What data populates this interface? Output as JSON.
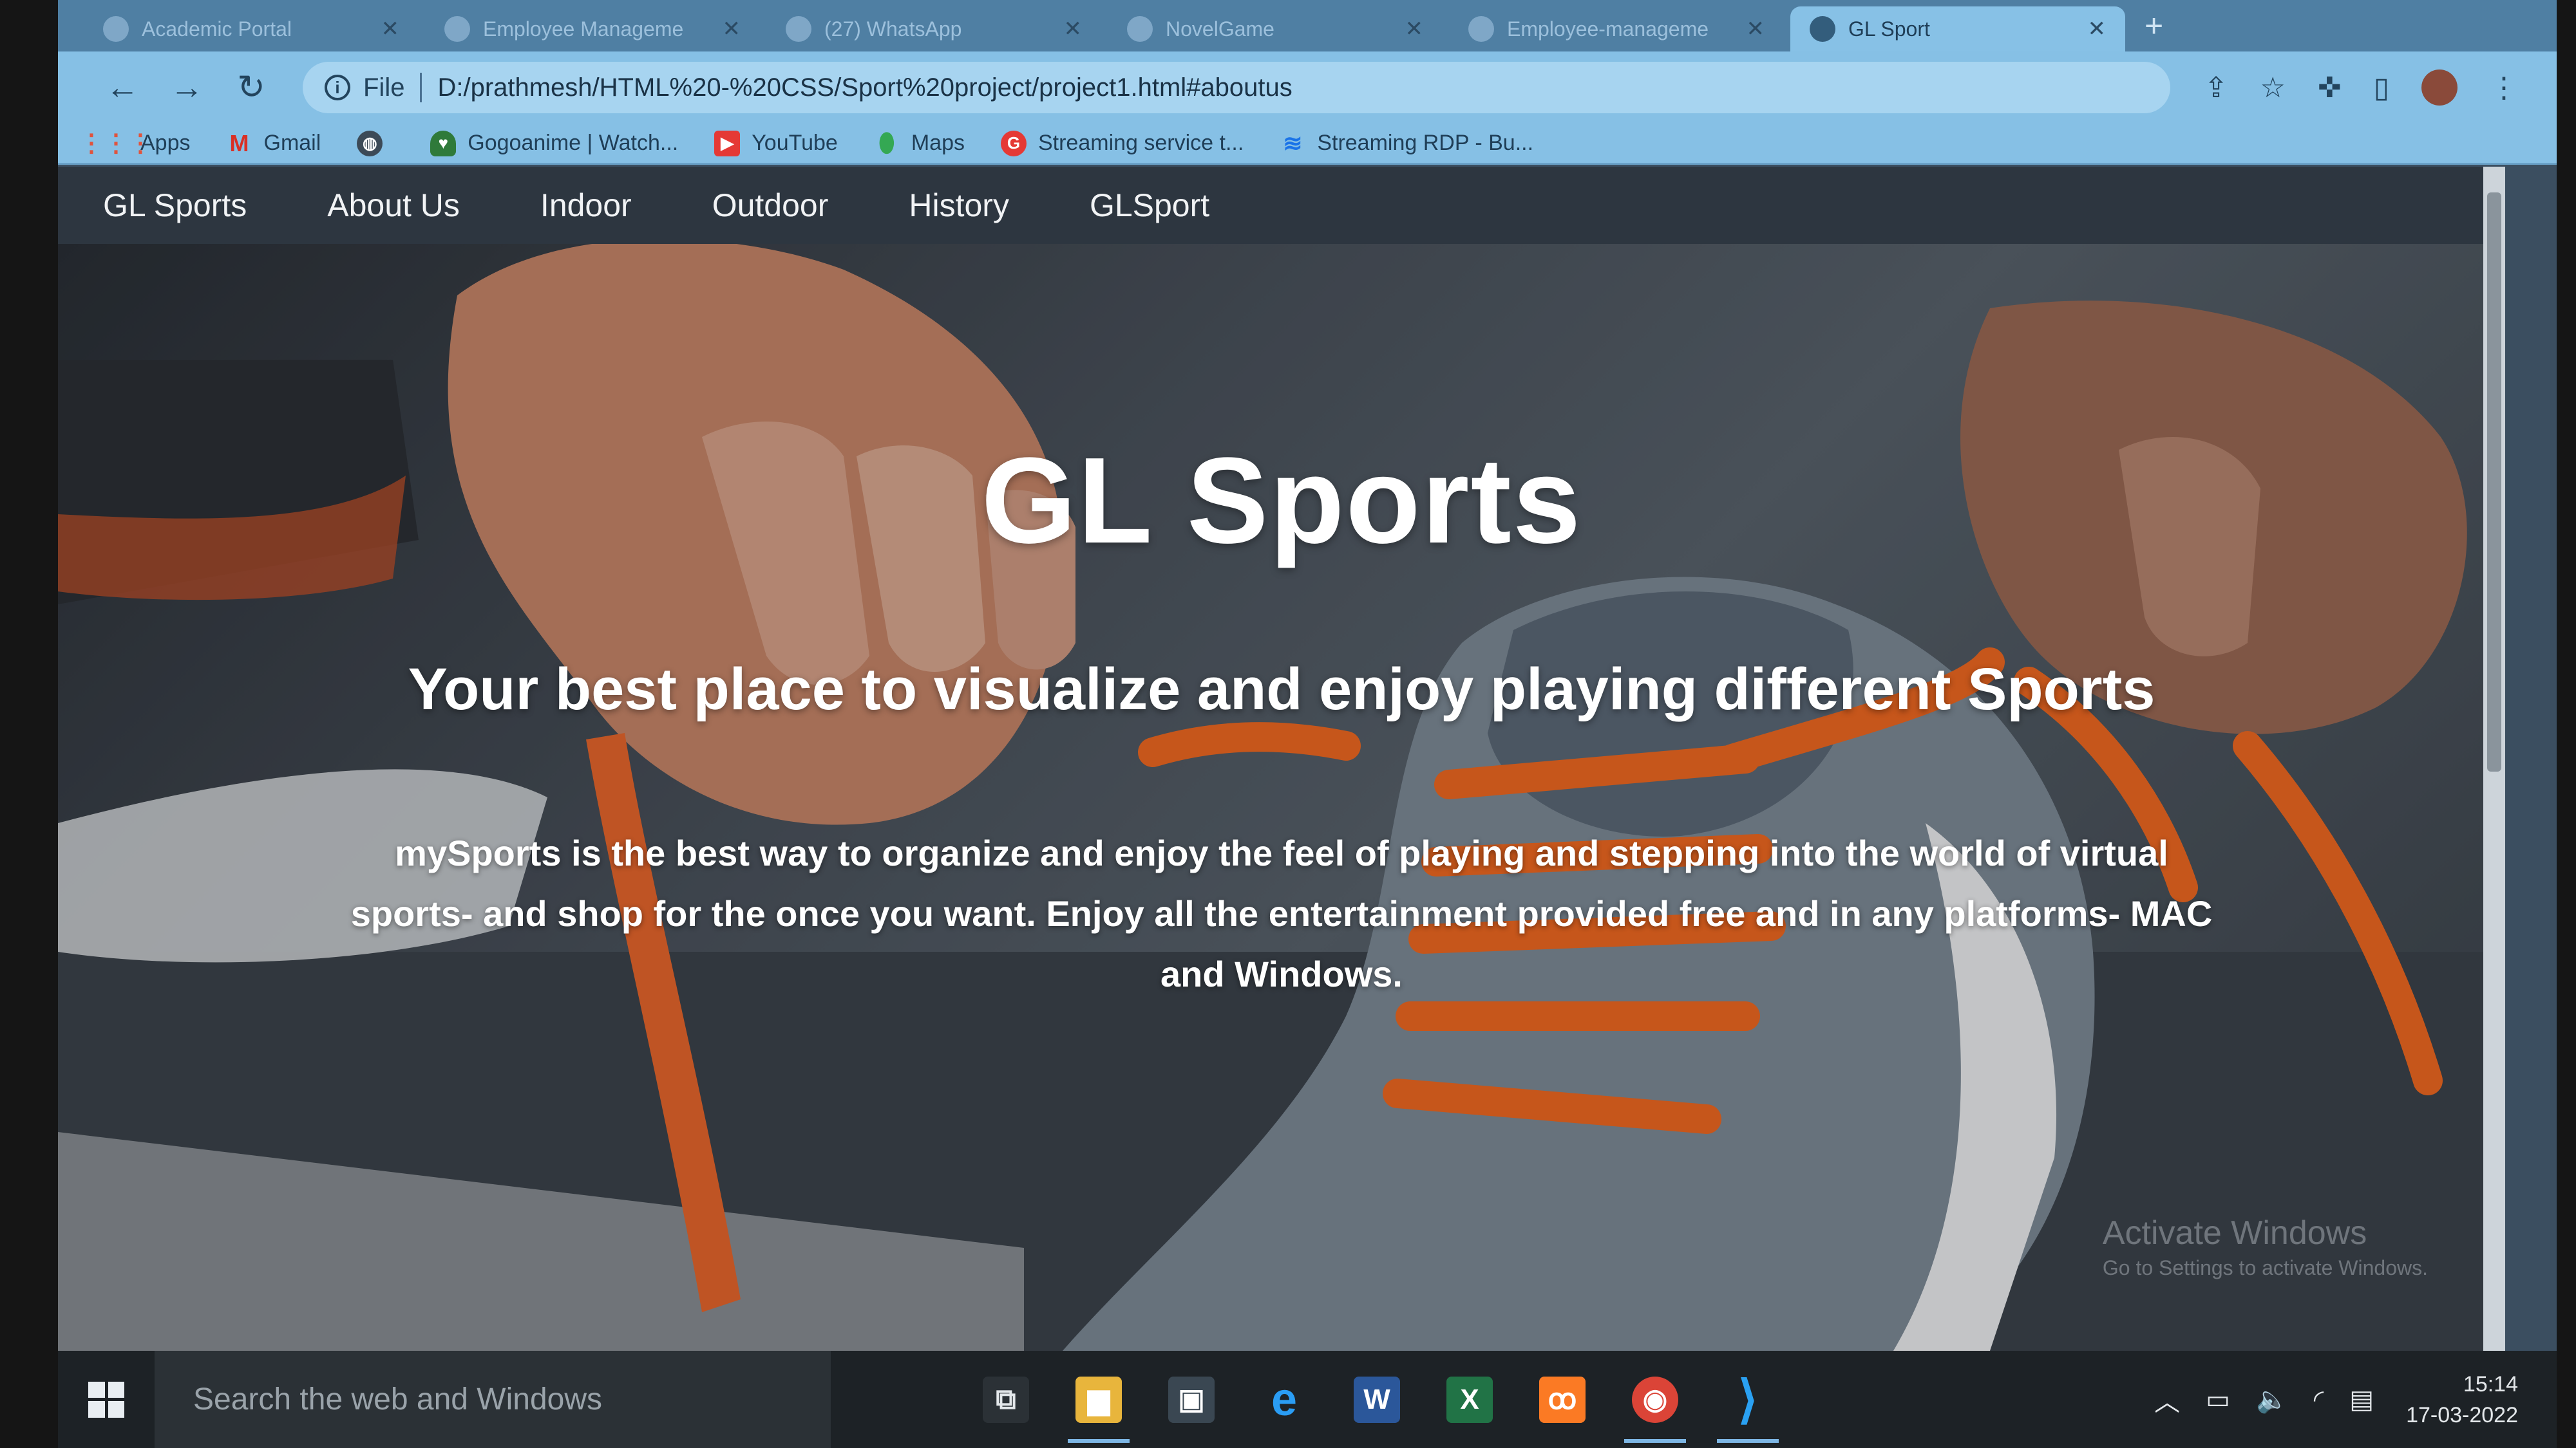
{
  "browser": {
    "tabs": [
      {
        "label": "Academic Portal",
        "active": false
      },
      {
        "label": "Employee Manageme",
        "active": false
      },
      {
        "label": "(27) WhatsApp",
        "active": false
      },
      {
        "label": "NovelGame",
        "active": false
      },
      {
        "label": "Employee-manageme",
        "active": false
      },
      {
        "label": "GL Sport",
        "active": true
      }
    ],
    "new_tab": "+",
    "url_scheme": "File",
    "url": "D:/prathmesh/HTML%20-%20CSS/Sport%20project/project1.html#aboutus",
    "bookmarks": [
      {
        "label": "Apps",
        "icon": "apps-grid-icon",
        "color": "#e0533d"
      },
      {
        "label": "Gmail",
        "icon": "gmail-icon",
        "color": "#d93025"
      },
      {
        "label": "",
        "icon": "globe-icon",
        "color": "#3c4a57"
      },
      {
        "label": "Gogoanime | Watch...",
        "icon": "gogoanime-icon",
        "color": "#2f7a3a"
      },
      {
        "label": "YouTube",
        "icon": "youtube-icon",
        "color": "#e53935"
      },
      {
        "label": "Maps",
        "icon": "maps-pin-icon",
        "color": "#34a853"
      },
      {
        "label": "Streaming service t...",
        "icon": "g-logo-icon",
        "color": "#e53935"
      },
      {
        "label": "Streaming RDP - Bu...",
        "icon": "rdp-icon",
        "color": "#1a73e8"
      }
    ]
  },
  "site": {
    "nav": [
      "GL Sports",
      "About Us",
      "Indoor",
      "Outdoor",
      "History",
      "GLSport"
    ],
    "hero_title": "GL Sports",
    "hero_subtitle": "Your best place to visualize and enjoy playing different Sports",
    "hero_description": "mySports is the best way to organize and enjoy the feel of playing and stepping into the world of virtual sports- and shop for the once you want. Enjoy all the entertainment provided free and in any platforms- MAC and Windows.",
    "watermark_title": "Activate Windows",
    "watermark_sub": "Go to Settings to activate Windows."
  },
  "taskbar": {
    "search_placeholder": "Search the web and Windows",
    "apps": [
      {
        "name": "task-view-icon",
        "color": "#2b3136",
        "glyph": "⧉"
      },
      {
        "name": "file-explorer-icon",
        "color": "#e8b53c",
        "glyph": "▆"
      },
      {
        "name": "store-icon",
        "color": "#3a4752",
        "glyph": "🛍"
      },
      {
        "name": "internet-explorer-icon",
        "color": "#1e88e5",
        "glyph": "e"
      },
      {
        "name": "word-icon",
        "color": "#2b579a",
        "glyph": "W"
      },
      {
        "name": "excel-icon",
        "color": "#217346",
        "glyph": "X"
      },
      {
        "name": "xampp-icon",
        "color": "#fb7a24",
        "glyph": "ꝏ"
      },
      {
        "name": "chrome-icon",
        "color": "#db4437",
        "glyph": "◉"
      },
      {
        "name": "vscode-icon",
        "color": "#1e90e0",
        "glyph": "⟩"
      }
    ],
    "time": "15:14",
    "date": "17-03-2022"
  }
}
